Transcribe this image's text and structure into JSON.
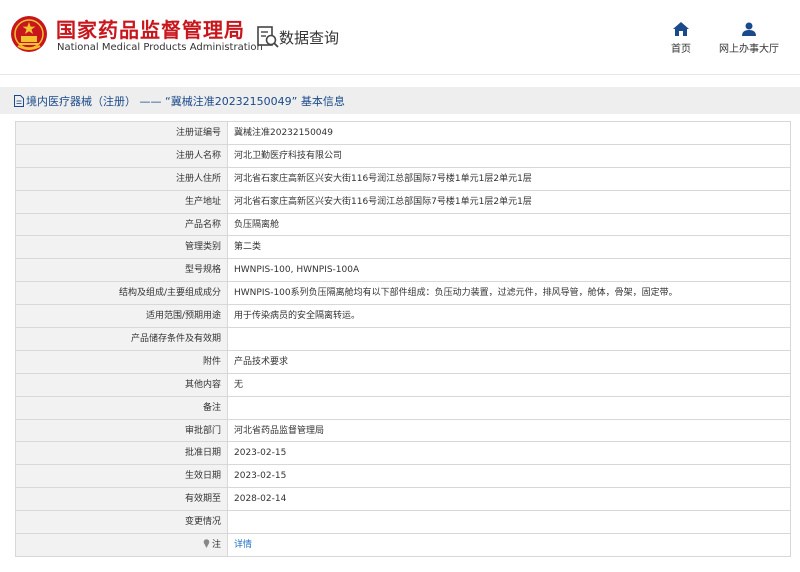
{
  "header": {
    "agency_cn": "国家药品监督管理局",
    "agency_en": "National Medical Products Administration",
    "page_heading": "数据查询",
    "nav": [
      {
        "label": "首页",
        "icon": "home-icon"
      },
      {
        "label": "网上办事大厅",
        "icon": "user-icon"
      }
    ]
  },
  "colors": {
    "brand_red": "#c8161d",
    "nav_blue": "#1a4a8a",
    "link_blue": "#1f6fc5"
  },
  "title_bar": {
    "text": "境内医疗器械（注册） —— “冀械注准20232150049” 基本信息"
  },
  "rows": [
    {
      "label": "注册证编号",
      "value": "冀械注准20232150049"
    },
    {
      "label": "注册人名称",
      "value": "河北卫勤医疗科技有限公司"
    },
    {
      "label": "注册人住所",
      "value": "河北省石家庄高新区兴安大街116号润江总部国际7号楼1单元1层2单元1层"
    },
    {
      "label": "生产地址",
      "value": "河北省石家庄高新区兴安大街116号润江总部国际7号楼1单元1层2单元1层"
    },
    {
      "label": "产品名称",
      "value": "负压隔离舱"
    },
    {
      "label": "管理类别",
      "value": "第二类"
    },
    {
      "label": "型号规格",
      "value": "HWNPIS-100, HWNPIS-100A"
    },
    {
      "label": "结构及组成/主要组成成分",
      "value": "HWNPIS-100系列负压隔离舱均有以下部件组成：负压动力装置，过滤元件，排风导管，舱体，骨架，固定带。"
    },
    {
      "label": "适用范围/预期用途",
      "value": "用于传染病员的安全隔离转运。"
    },
    {
      "label": "产品储存条件及有效期",
      "value": ""
    },
    {
      "label": "附件",
      "value": "产品技术要求"
    },
    {
      "label": "其他内容",
      "value": "无"
    },
    {
      "label": "备注",
      "value": ""
    },
    {
      "label": "审批部门",
      "value": "河北省药品监督管理局"
    },
    {
      "label": "批准日期",
      "value": "2023-02-15"
    },
    {
      "label": "生效日期",
      "value": "2023-02-15"
    },
    {
      "label": "有效期至",
      "value": "2028-02-14"
    },
    {
      "label": "变更情况",
      "value": ""
    }
  ],
  "note_row": {
    "label": "注",
    "link": "详情"
  }
}
